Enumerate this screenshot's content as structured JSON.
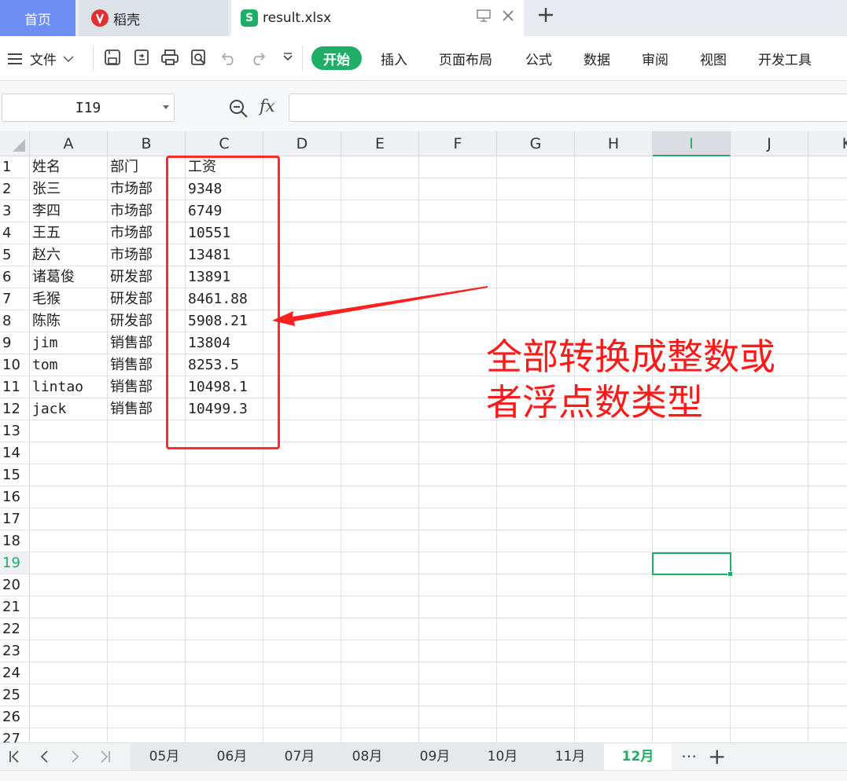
{
  "tabs": {
    "home": "首页",
    "daoke": "稻壳",
    "file": "result.xlsx"
  },
  "ribbon": {
    "menu_label": "文件",
    "start": "开始",
    "items": [
      "插入",
      "页面布局",
      "公式",
      "数据",
      "审阅",
      "视图",
      "开发工具"
    ]
  },
  "formula_bar": {
    "name_box": "I19",
    "fx": "fx",
    "value": ""
  },
  "grid": {
    "columns": [
      "A",
      "B",
      "C",
      "D",
      "E",
      "F",
      "G",
      "H",
      "I",
      "J",
      "K"
    ],
    "selected_column": "I",
    "rows": [
      "1",
      "2",
      "3",
      "4",
      "5",
      "6",
      "7",
      "8",
      "9",
      "10",
      "11",
      "12",
      "13",
      "14",
      "15",
      "16",
      "17",
      "18",
      "19",
      "20",
      "21",
      "22",
      "23",
      "24",
      "25",
      "26",
      "27"
    ],
    "selected_row": "19",
    "data": [
      [
        "姓名",
        "部门",
        "工资"
      ],
      [
        "张三",
        "市场部",
        "9348"
      ],
      [
        "李四",
        "市场部",
        "6749"
      ],
      [
        "王五",
        "市场部",
        "10551"
      ],
      [
        "赵六",
        "市场部",
        "13481"
      ],
      [
        "诸葛俊",
        "研发部",
        "13891"
      ],
      [
        "毛猴",
        "研发部",
        "8461.88"
      ],
      [
        "陈陈",
        "研发部",
        "5908.21"
      ],
      [
        "jim",
        "销售部",
        "13804"
      ],
      [
        "tom",
        "销售部",
        "8253.5"
      ],
      [
        "lintao",
        "销售部",
        "10498.1"
      ],
      [
        "jack",
        "销售部",
        "10499.3"
      ]
    ]
  },
  "annotation": {
    "line1": "全部转换成整数或",
    "line2": "者浮点数类型",
    "color": "#ff1a1a"
  },
  "sheets": {
    "tabs": [
      "05月",
      "06月",
      "07月",
      "08月",
      "09月",
      "10月",
      "11月",
      "12月"
    ],
    "active": "12月"
  },
  "colors": {
    "accent": "#1fae66",
    "home_tab": "#6c8ef5"
  }
}
